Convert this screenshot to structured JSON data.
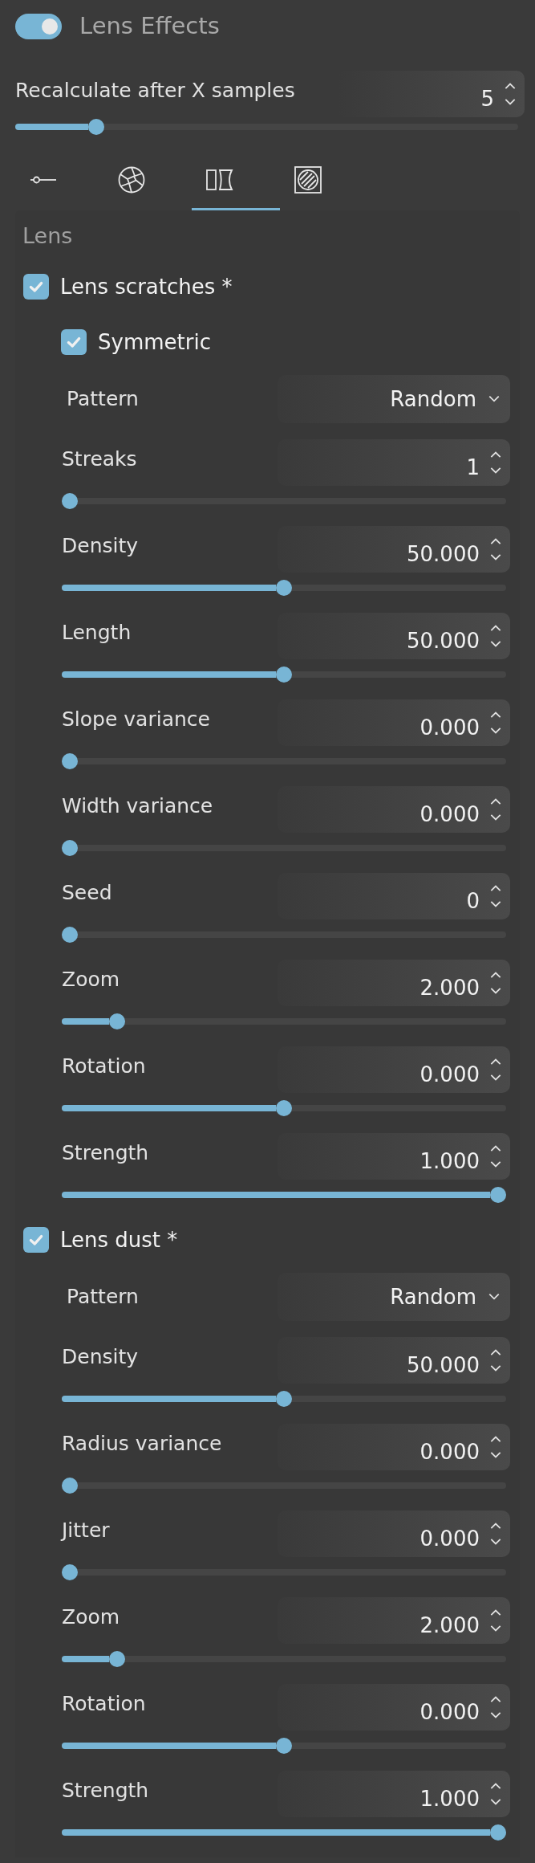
{
  "header": {
    "toggle_on": true,
    "title": "Lens Effects"
  },
  "recalc": {
    "label": "Recalculate after X samples",
    "value": "5",
    "level": 0.15
  },
  "tabs": [
    {
      "kind": "exposure",
      "selected": false
    },
    {
      "kind": "aperture",
      "selected": false
    },
    {
      "kind": "lens",
      "selected": true
    },
    {
      "kind": "filter",
      "selected": false
    }
  ],
  "panel": {
    "title": "Lens",
    "groups": [
      {
        "label": "Lens scratches *",
        "checked": true,
        "items": [
          {
            "kind": "checkbox",
            "label": "Symmetric",
            "checked": true
          },
          {
            "kind": "dropdown",
            "label": "Pattern",
            "value": "Random"
          },
          {
            "kind": "slider",
            "label": "Streaks",
            "value": "1",
            "level": 0
          },
          {
            "kind": "slider",
            "label": "Density",
            "value": "50.000",
            "level": 0.5
          },
          {
            "kind": "slider",
            "label": "Length",
            "value": "50.000",
            "level": 0.5
          },
          {
            "kind": "slider",
            "label": "Slope variance",
            "value": "0.000",
            "level": 0
          },
          {
            "kind": "slider",
            "label": "Width variance",
            "value": "0.000",
            "level": 0
          },
          {
            "kind": "slider",
            "label": "Seed",
            "value": "0",
            "level": 0
          },
          {
            "kind": "slider",
            "label": "Zoom",
            "value": "2.000",
            "level": 0.11
          },
          {
            "kind": "slider",
            "label": "Rotation",
            "value": "0.000",
            "level": 0.5
          },
          {
            "kind": "slider",
            "label": "Strength",
            "value": "1.000",
            "level": 1
          }
        ]
      },
      {
        "label": "Lens dust *",
        "checked": true,
        "items": [
          {
            "kind": "dropdown",
            "label": "Pattern",
            "value": "Random"
          },
          {
            "kind": "slider",
            "label": "Density",
            "value": "50.000",
            "level": 0.5
          },
          {
            "kind": "slider",
            "label": "Radius variance",
            "value": "0.000",
            "level": 0
          },
          {
            "kind": "slider",
            "label": "Jitter",
            "value": "0.000",
            "level": 0
          },
          {
            "kind": "slider",
            "label": "Zoom",
            "value": "2.000",
            "level": 0.11
          },
          {
            "kind": "slider",
            "label": "Rotation",
            "value": "0.000",
            "level": 0.5
          },
          {
            "kind": "slider",
            "label": "Strength",
            "value": "1.000",
            "level": 1
          }
        ]
      }
    ]
  }
}
